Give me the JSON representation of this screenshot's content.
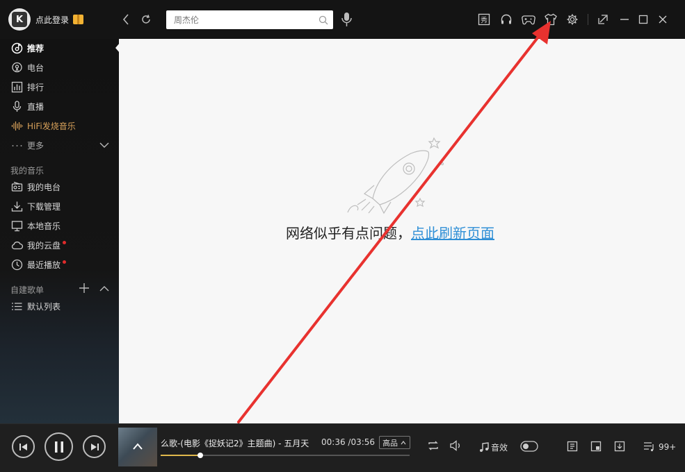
{
  "header": {
    "login_label": "点此登录",
    "search_placeholder": "周杰伦",
    "toolbar_icons": [
      "show-icon",
      "headphones-icon",
      "gamepad-icon",
      "skin-shirt-icon",
      "settings-gear-icon"
    ],
    "window_controls": [
      "mini-mode-icon",
      "minimize-icon",
      "maximize-icon",
      "close-icon"
    ]
  },
  "sidebar": {
    "main_items": [
      {
        "label": "推荐",
        "icon": "disc-icon"
      },
      {
        "label": "电台",
        "icon": "radio-tower-icon"
      },
      {
        "label": "排行",
        "icon": "ranking-bars-icon"
      },
      {
        "label": "直播",
        "icon": "microphone-icon"
      },
      {
        "label": "HiFi发烧音乐",
        "icon": "waveform-icon"
      },
      {
        "label": "更多",
        "icon": "dots-icon"
      }
    ],
    "my_music_title": "我的音乐",
    "my_music_items": [
      {
        "label": "我的电台",
        "icon": "my-radio-icon"
      },
      {
        "label": "下载管理",
        "icon": "download-icon"
      },
      {
        "label": "本地音乐",
        "icon": "monitor-icon"
      },
      {
        "label": "我的云盘",
        "icon": "cloud-icon"
      },
      {
        "label": "最近播放",
        "icon": "clock-icon"
      }
    ],
    "playlist_title": "自建歌单",
    "playlist_items": [
      {
        "label": "默认列表",
        "icon": "list-icon"
      }
    ]
  },
  "main": {
    "error_text": "网络似乎有点问题，",
    "refresh_link": "点此刷新页面"
  },
  "player": {
    "song_title": "么歌-(电影《捉妖记2》主题曲) - 五月天",
    "elapsed": "00:36",
    "separator": "/",
    "duration": "03:56",
    "quality_label": "高品",
    "progress_fraction": 0.16,
    "effects_label": "音效",
    "playlist_count": "99+"
  },
  "colors": {
    "accent_link": "#2f8fd6",
    "hifi": "#d8a15a",
    "progress": "#e0b84c",
    "annotation_arrow": "#e8322f"
  }
}
